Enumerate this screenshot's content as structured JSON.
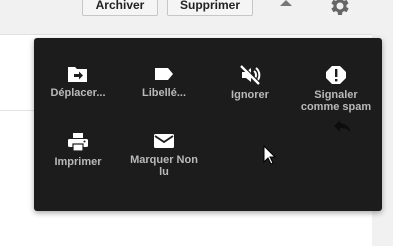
{
  "toolbar": {
    "archive_label": "Archiver",
    "delete_label": "Supprimer"
  },
  "menu": {
    "items": [
      {
        "label": "Déplacer...",
        "icon": "move-to-folder-icon"
      },
      {
        "label": "Libellé...",
        "icon": "label-tag-icon"
      },
      {
        "label": "Ignorer",
        "icon": "mute-icon"
      },
      {
        "label": "Signaler comme spam",
        "icon": "report-spam-icon"
      },
      {
        "label": "Imprimer",
        "icon": "print-icon"
      },
      {
        "label": "Marquer Non lu",
        "icon": "mark-unread-icon"
      }
    ]
  },
  "colors": {
    "menu_bg": "#1c1c1c",
    "menu_text": "#b9b9b9",
    "icon": "#ffffff",
    "topbar_bg": "#f1f1f1"
  }
}
